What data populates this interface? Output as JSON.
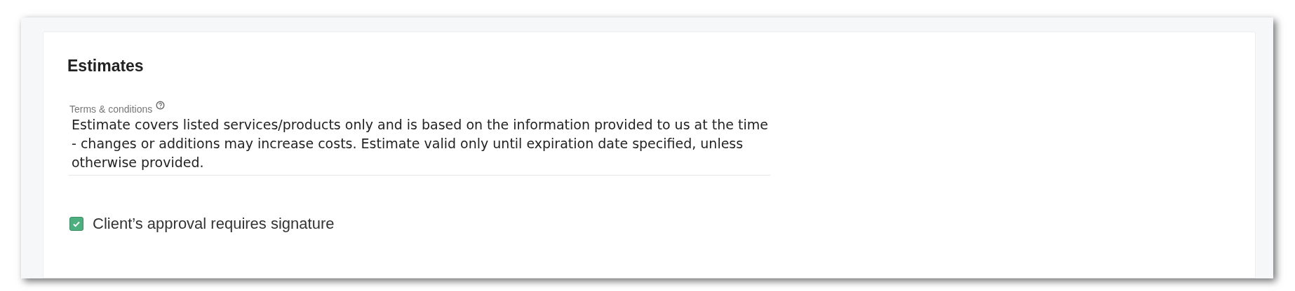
{
  "section": {
    "title": "Estimates"
  },
  "terms_field": {
    "label": "Terms & conditions",
    "value": "Estimate covers listed services/products only and is based on the information provided to us at the time - changes or additions may increase costs. Estimate valid only until expiration date specified, unless otherwise provided."
  },
  "signature_checkbox": {
    "label": "Client’s approval requires signature",
    "checked": true
  }
}
